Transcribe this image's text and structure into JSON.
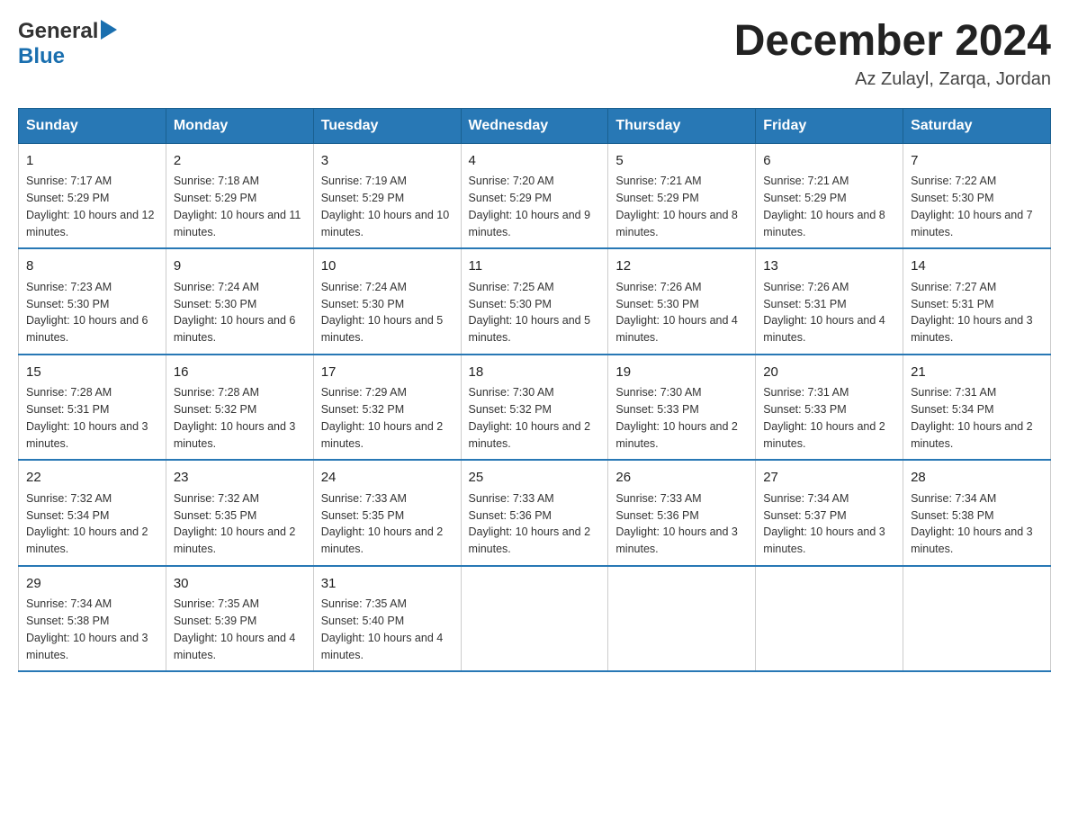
{
  "header": {
    "logo": {
      "general": "General",
      "blue": "Blue"
    },
    "title": "December 2024",
    "location": "Az Zulayl, Zarqa, Jordan"
  },
  "days": [
    "Sunday",
    "Monday",
    "Tuesday",
    "Wednesday",
    "Thursday",
    "Friday",
    "Saturday"
  ],
  "weeks": [
    [
      {
        "num": "1",
        "sunrise": "7:17 AM",
        "sunset": "5:29 PM",
        "daylight": "10 hours and 12 minutes."
      },
      {
        "num": "2",
        "sunrise": "7:18 AM",
        "sunset": "5:29 PM",
        "daylight": "10 hours and 11 minutes."
      },
      {
        "num": "3",
        "sunrise": "7:19 AM",
        "sunset": "5:29 PM",
        "daylight": "10 hours and 10 minutes."
      },
      {
        "num": "4",
        "sunrise": "7:20 AM",
        "sunset": "5:29 PM",
        "daylight": "10 hours and 9 minutes."
      },
      {
        "num": "5",
        "sunrise": "7:21 AM",
        "sunset": "5:29 PM",
        "daylight": "10 hours and 8 minutes."
      },
      {
        "num": "6",
        "sunrise": "7:21 AM",
        "sunset": "5:29 PM",
        "daylight": "10 hours and 8 minutes."
      },
      {
        "num": "7",
        "sunrise": "7:22 AM",
        "sunset": "5:30 PM",
        "daylight": "10 hours and 7 minutes."
      }
    ],
    [
      {
        "num": "8",
        "sunrise": "7:23 AM",
        "sunset": "5:30 PM",
        "daylight": "10 hours and 6 minutes."
      },
      {
        "num": "9",
        "sunrise": "7:24 AM",
        "sunset": "5:30 PM",
        "daylight": "10 hours and 6 minutes."
      },
      {
        "num": "10",
        "sunrise": "7:24 AM",
        "sunset": "5:30 PM",
        "daylight": "10 hours and 5 minutes."
      },
      {
        "num": "11",
        "sunrise": "7:25 AM",
        "sunset": "5:30 PM",
        "daylight": "10 hours and 5 minutes."
      },
      {
        "num": "12",
        "sunrise": "7:26 AM",
        "sunset": "5:30 PM",
        "daylight": "10 hours and 4 minutes."
      },
      {
        "num": "13",
        "sunrise": "7:26 AM",
        "sunset": "5:31 PM",
        "daylight": "10 hours and 4 minutes."
      },
      {
        "num": "14",
        "sunrise": "7:27 AM",
        "sunset": "5:31 PM",
        "daylight": "10 hours and 3 minutes."
      }
    ],
    [
      {
        "num": "15",
        "sunrise": "7:28 AM",
        "sunset": "5:31 PM",
        "daylight": "10 hours and 3 minutes."
      },
      {
        "num": "16",
        "sunrise": "7:28 AM",
        "sunset": "5:32 PM",
        "daylight": "10 hours and 3 minutes."
      },
      {
        "num": "17",
        "sunrise": "7:29 AM",
        "sunset": "5:32 PM",
        "daylight": "10 hours and 2 minutes."
      },
      {
        "num": "18",
        "sunrise": "7:30 AM",
        "sunset": "5:32 PM",
        "daylight": "10 hours and 2 minutes."
      },
      {
        "num": "19",
        "sunrise": "7:30 AM",
        "sunset": "5:33 PM",
        "daylight": "10 hours and 2 minutes."
      },
      {
        "num": "20",
        "sunrise": "7:31 AM",
        "sunset": "5:33 PM",
        "daylight": "10 hours and 2 minutes."
      },
      {
        "num": "21",
        "sunrise": "7:31 AM",
        "sunset": "5:34 PM",
        "daylight": "10 hours and 2 minutes."
      }
    ],
    [
      {
        "num": "22",
        "sunrise": "7:32 AM",
        "sunset": "5:34 PM",
        "daylight": "10 hours and 2 minutes."
      },
      {
        "num": "23",
        "sunrise": "7:32 AM",
        "sunset": "5:35 PM",
        "daylight": "10 hours and 2 minutes."
      },
      {
        "num": "24",
        "sunrise": "7:33 AM",
        "sunset": "5:35 PM",
        "daylight": "10 hours and 2 minutes."
      },
      {
        "num": "25",
        "sunrise": "7:33 AM",
        "sunset": "5:36 PM",
        "daylight": "10 hours and 2 minutes."
      },
      {
        "num": "26",
        "sunrise": "7:33 AM",
        "sunset": "5:36 PM",
        "daylight": "10 hours and 3 minutes."
      },
      {
        "num": "27",
        "sunrise": "7:34 AM",
        "sunset": "5:37 PM",
        "daylight": "10 hours and 3 minutes."
      },
      {
        "num": "28",
        "sunrise": "7:34 AM",
        "sunset": "5:38 PM",
        "daylight": "10 hours and 3 minutes."
      }
    ],
    [
      {
        "num": "29",
        "sunrise": "7:34 AM",
        "sunset": "5:38 PM",
        "daylight": "10 hours and 3 minutes."
      },
      {
        "num": "30",
        "sunrise": "7:35 AM",
        "sunset": "5:39 PM",
        "daylight": "10 hours and 4 minutes."
      },
      {
        "num": "31",
        "sunrise": "7:35 AM",
        "sunset": "5:40 PM",
        "daylight": "10 hours and 4 minutes."
      },
      null,
      null,
      null,
      null
    ]
  ]
}
